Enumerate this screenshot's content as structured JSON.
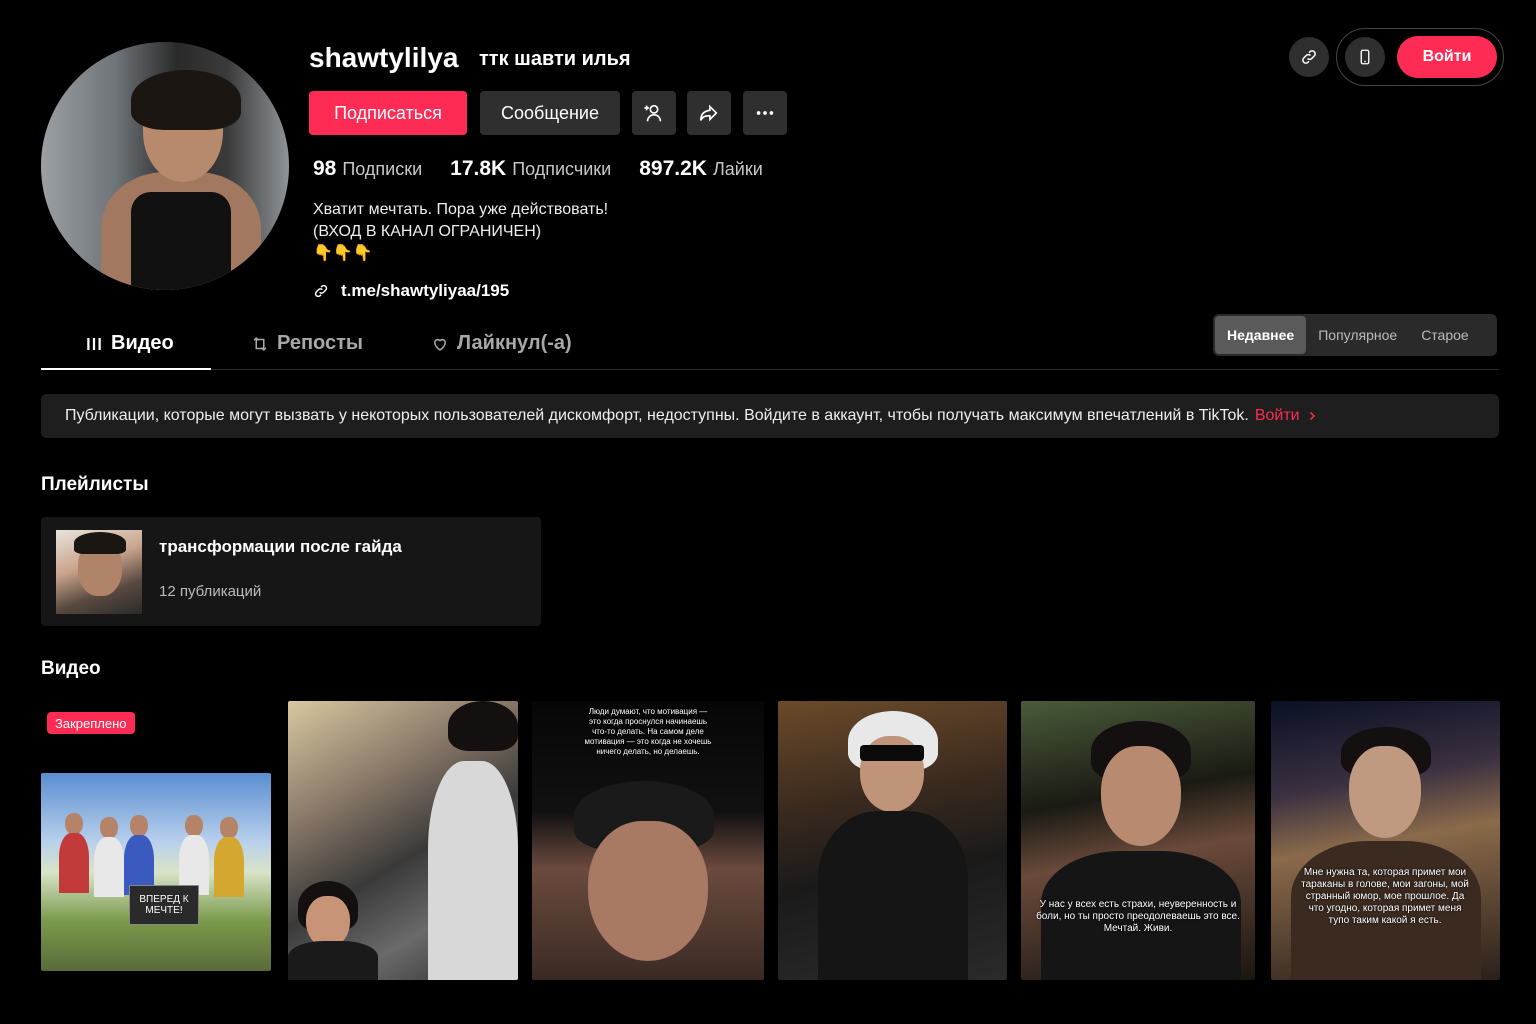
{
  "profile": {
    "username": "shawtylilya",
    "nickname": "ттк шавти илья",
    "follow_label": "Подписаться",
    "message_label": "Сообщение",
    "stats": [
      {
        "value": "98",
        "label": "Подписки"
      },
      {
        "value": "17.8K",
        "label": "Подписчики"
      },
      {
        "value": "897.2K",
        "label": "Лайки"
      }
    ],
    "bio": "Хватит мечтать. Пора уже действовать!\n(ВХОД В КАНАЛ ОГРАНИЧЕН)\n👇👇👇",
    "link": "t.me/shawtyliyaa/195"
  },
  "header": {
    "login_label": "Войти"
  },
  "tabs": [
    {
      "label": "Видео",
      "icon": "grid-icon"
    },
    {
      "label": "Репосты",
      "icon": "repost-icon"
    },
    {
      "label": "Лайкнул(-а)",
      "icon": "heart-icon"
    }
  ],
  "sort": [
    "Недавнее",
    "Популярное",
    "Старое"
  ],
  "banner": {
    "text": "Публикации, которые могут вызвать у некоторых пользователей дискомфорт, недоступны. Войдите в аккаунт, чтобы получать максимум впечатлений в TikTok.",
    "link": "Войти"
  },
  "playlists": {
    "title": "Плейлисты",
    "items": [
      {
        "title": "трансформации после гайда",
        "count": "12 публикаций"
      }
    ]
  },
  "videos": {
    "title": "Видео",
    "pinned_label": "Закреплено",
    "v1_sign": "ВПЕРЕД К МЕЧТЕ!",
    "v3_text": "Люди думают, что мотивация — это когда проснулся начинаешь что-то делать. На самом деле мотивация — это когда не хочешь ничего делать, но делаешь.",
    "v5_text": "У нас у всех есть страхи, неуверенность и боли, но ты просто преодолеваешь это все. Мечтай. Живи.",
    "v6_text": "Мне нужна та, которая примет мои тараканы в голове, мои загоны, мой странный юмор, мое прошлое. Да что угодно, которая примет меня тупо таким какой я есть."
  },
  "colors": {
    "accent": "#fe2c55",
    "background": "#000000",
    "surface": "#1e1e1e"
  }
}
